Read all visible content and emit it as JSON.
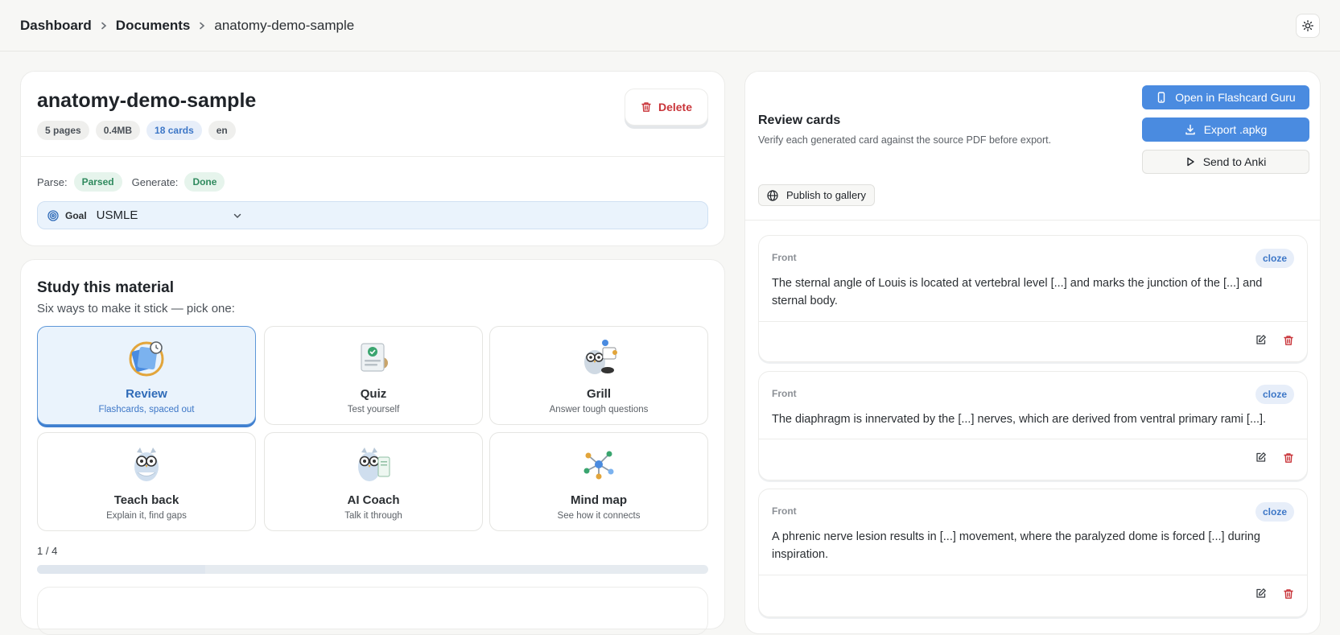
{
  "breadcrumb": [
    "Dashboard",
    "Documents",
    "anatomy-demo-sample"
  ],
  "document": {
    "title": "anatomy-demo-sample",
    "chips": [
      "5 pages",
      "0.4MB",
      "18 cards",
      "en"
    ],
    "delete_label": "Delete",
    "parse_label": "Parse:",
    "parse_status": "Parsed",
    "generate_label": "Generate:",
    "generate_status": "Done",
    "goal_label": "Goal",
    "goal_value": "USMLE"
  },
  "study": {
    "title": "Study this material",
    "subtitle": "Six ways to make it stick — pick one:",
    "modes": [
      {
        "name": "Review",
        "desc": "Flashcards, spaced out"
      },
      {
        "name": "Quiz",
        "desc": "Test yourself"
      },
      {
        "name": "Grill",
        "desc": "Answer tough questions"
      },
      {
        "name": "Teach back",
        "desc": "Explain it, find gaps"
      },
      {
        "name": "AI Coach",
        "desc": "Talk it through"
      },
      {
        "name": "Mind map",
        "desc": "See how it connects"
      }
    ],
    "progress_label": "1 / 4",
    "progress_fraction": 0.25
  },
  "review": {
    "title": "Review cards",
    "subtitle": "Verify each generated card against the source PDF before export.",
    "open_label": "Open in Flashcard Guru",
    "export_label": "Export .apkg",
    "anki_label": "Send to Anki",
    "publish_label": "Publish to gallery",
    "cards": [
      {
        "side": "Front",
        "type": "cloze",
        "text": "The sternal angle of Louis is located at vertebral level [...] and marks the junction of the [...] and sternal body."
      },
      {
        "side": "Front",
        "type": "cloze",
        "text": "The diaphragm is innervated by the [...] nerves, which are derived from ventral primary rami [...]."
      },
      {
        "side": "Front",
        "type": "cloze",
        "text": "A phrenic nerve lesion results in [...] movement, where the paralyzed dome is forced [...] during inspiration."
      }
    ]
  },
  "colors": {
    "accent": "#4a8be0",
    "danger": "#c9353a",
    "success": "#2f8a5e"
  }
}
